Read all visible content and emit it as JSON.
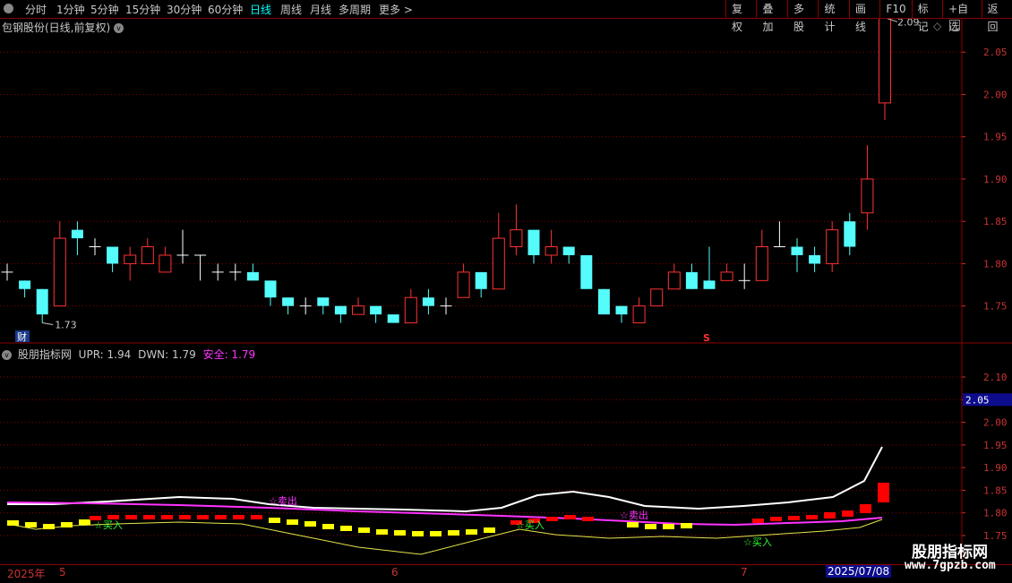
{
  "toolbar": {
    "periods": [
      "分时",
      "1分钟",
      "5分钟",
      "15分钟",
      "30分钟",
      "60分钟",
      "日线",
      "周线",
      "月线",
      "多周期",
      "更多"
    ],
    "active_period": "日线",
    "buttons": [
      "复权",
      "叠加",
      "多股",
      "统计",
      "画线",
      "F10",
      "标记",
      "+自选",
      "返回"
    ]
  },
  "main_pane": {
    "title": "包钢股份(日线,前复权)",
    "price_ticks": [
      "2.05",
      "2.00",
      "1.95",
      "1.90",
      "1.85",
      "1.80",
      "1.75"
    ],
    "high_label": "2.09",
    "low_label": "1.73",
    "finance_badge": "财",
    "sell_marker": "S",
    "up_color": "#ff3232",
    "down_color": "#54fcfc"
  },
  "indicator_pane": {
    "name": "股朋指标网",
    "upr_label": "UPR: 1.94",
    "dwn_label": "DWN: 1.79",
    "safe_label": "安全: 1.79",
    "ticks": [
      "2.10",
      "2.05",
      "2.00",
      "1.95",
      "1.90",
      "1.85",
      "1.80",
      "1.75"
    ],
    "current_value": "2.05",
    "signals": [
      "☆卖出",
      "☆买入",
      "☆买入",
      "☆卖出",
      "☆买入"
    ]
  },
  "date_axis": {
    "labels": [
      "2025年",
      "5",
      "6",
      "7"
    ],
    "current_date": "2025/07/08"
  },
  "watermark": {
    "name": "股朋指标网",
    "url": "www.7gpzb.com"
  },
  "chart_data": {
    "type": "candlestick",
    "candles": [
      [
        1.79,
        1.79,
        1.8,
        1.78
      ],
      [
        1.78,
        1.77,
        1.78,
        1.76
      ],
      [
        1.77,
        1.74,
        1.77,
        1.73
      ],
      [
        1.75,
        1.83,
        1.85,
        1.75
      ],
      [
        1.84,
        1.83,
        1.85,
        1.81
      ],
      [
        1.82,
        1.82,
        1.83,
        1.81
      ],
      [
        1.82,
        1.8,
        1.82,
        1.79
      ],
      [
        1.8,
        1.81,
        1.82,
        1.78
      ],
      [
        1.8,
        1.82,
        1.83,
        1.8
      ],
      [
        1.79,
        1.81,
        1.82,
        1.79
      ],
      [
        1.81,
        1.81,
        1.84,
        1.8
      ],
      [
        1.81,
        1.81,
        1.81,
        1.78
      ],
      [
        1.79,
        1.79,
        1.8,
        1.78
      ],
      [
        1.79,
        1.79,
        1.8,
        1.78
      ],
      [
        1.79,
        1.78,
        1.8,
        1.78
      ],
      [
        1.78,
        1.76,
        1.78,
        1.75
      ],
      [
        1.76,
        1.75,
        1.76,
        1.74
      ],
      [
        1.75,
        1.75,
        1.76,
        1.74
      ],
      [
        1.76,
        1.75,
        1.76,
        1.74
      ],
      [
        1.75,
        1.74,
        1.75,
        1.73
      ],
      [
        1.74,
        1.75,
        1.76,
        1.74
      ],
      [
        1.75,
        1.74,
        1.75,
        1.73
      ],
      [
        1.74,
        1.73,
        1.74,
        1.73
      ],
      [
        1.73,
        1.76,
        1.77,
        1.73
      ],
      [
        1.76,
        1.75,
        1.77,
        1.74
      ],
      [
        1.75,
        1.75,
        1.76,
        1.74
      ],
      [
        1.76,
        1.79,
        1.8,
        1.76
      ],
      [
        1.79,
        1.77,
        1.79,
        1.76
      ],
      [
        1.77,
        1.83,
        1.86,
        1.77
      ],
      [
        1.82,
        1.84,
        1.87,
        1.81
      ],
      [
        1.84,
        1.81,
        1.84,
        1.8
      ],
      [
        1.81,
        1.82,
        1.84,
        1.8
      ],
      [
        1.82,
        1.81,
        1.82,
        1.8
      ],
      [
        1.81,
        1.77,
        1.81,
        1.77
      ],
      [
        1.77,
        1.74,
        1.77,
        1.74
      ],
      [
        1.75,
        1.74,
        1.75,
        1.73
      ],
      [
        1.73,
        1.75,
        1.76,
        1.73
      ],
      [
        1.75,
        1.77,
        1.77,
        1.75
      ],
      [
        1.77,
        1.79,
        1.8,
        1.77
      ],
      [
        1.79,
        1.77,
        1.8,
        1.77
      ],
      [
        1.78,
        1.77,
        1.82,
        1.77
      ],
      [
        1.78,
        1.79,
        1.8,
        1.78
      ],
      [
        1.78,
        1.78,
        1.8,
        1.77
      ],
      [
        1.78,
        1.82,
        1.84,
        1.78
      ],
      [
        1.82,
        1.82,
        1.85,
        1.82
      ],
      [
        1.82,
        1.81,
        1.83,
        1.79
      ],
      [
        1.81,
        1.8,
        1.82,
        1.79
      ],
      [
        1.8,
        1.84,
        1.85,
        1.79
      ],
      [
        1.85,
        1.82,
        1.86,
        1.81
      ],
      [
        1.86,
        1.9,
        1.94,
        1.84
      ],
      [
        1.99,
        2.09,
        2.09,
        1.97
      ]
    ],
    "ylim": [
      1.72,
      2.1
    ]
  }
}
